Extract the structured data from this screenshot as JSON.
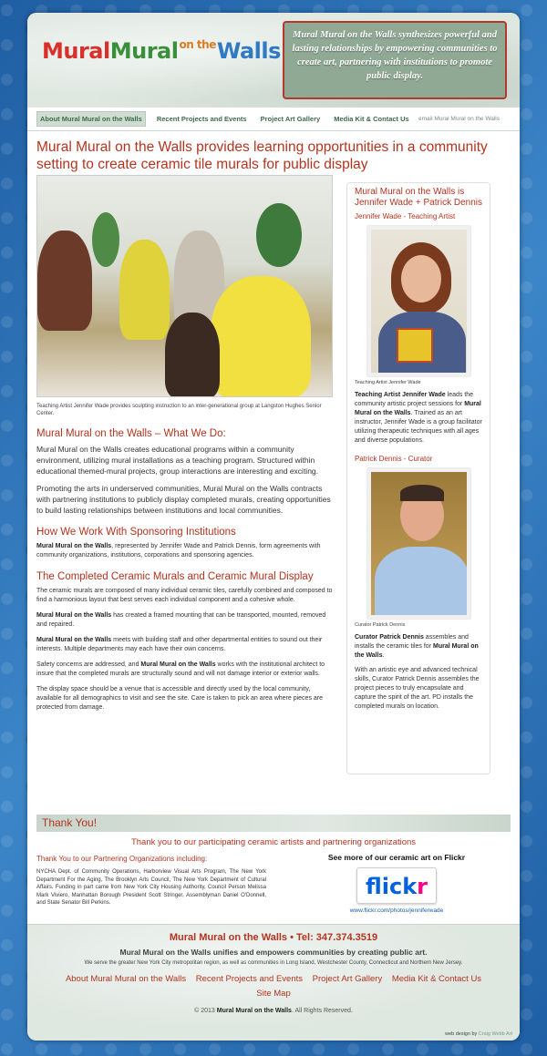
{
  "header": {
    "logo": [
      "Mural ",
      "Mural ",
      "on the",
      " Walls"
    ],
    "tagline": "Mural Mural on the Walls synthesizes powerful and lasting relationships by empowering communities to create art, partnering with institutions to promote public display."
  },
  "nav": {
    "items": [
      "About Mural Mural on the Walls",
      "Recent Projects and Events",
      "Project Art Gallery",
      "Media Kit & Contact Us"
    ],
    "email": "email Mural Mural on the Walls"
  },
  "headline": "Mural Mural on the Walls provides learning opportunities in a community setting to create ceramic tile murals for public display",
  "main": {
    "photo_caption": "Teaching Artist Jennifer Wade provides sculpting instruction to an inter-generational group at Langston Hughes Senior Center.",
    "s1_title": "Mural Mural on the Walls – What We Do:",
    "s1_p1": "Mural Mural on the Walls creates educational programs within a community environment, utilizing mural installations as a teaching program. Structured within educational themed-mural projects, group interactions are interesting and exciting.",
    "s1_p2": "Promoting the arts in underserved communities, Mural Mural on the Walls contracts with partnering institutions to publicly display completed murals, creating opportunities to build lasting relationships between institutions and local communities.",
    "s2_title": "How We Work With Sponsoring Institutions",
    "s2_b": "Mural Mural on the Walls",
    "s2_p": ", represented by Jennifer Wade and Patrick Dennis, form agreements with community organizations, institutions, corporations and sponsoring agencies.",
    "s3_title": "The Completed Ceramic Murals and Ceramic Mural Display",
    "s3_p1": "The ceramic murals are composed of many individual ceramic tiles, carefully combined and composed to find a harmonious layout that best serves each individual component and a cohesive whole.",
    "s3_p2b": "Mural Mural on the Walls",
    "s3_p2": " has created a framed mounting that can be transported, mounted, removed and repaired.",
    "s3_p3b": "Mural Mural on the Walls",
    "s3_p3": " meets with building staff and other departmental entities to sound out their interests. Multiple departments may each have their own concerns.",
    "s3_p4a": "Safety concerns are addressed, and ",
    "s3_p4b": "Mural Mural on the Walls",
    "s3_p4c": " works with the institutional architect to insure that the completed murals are structurally sound and will not damage interior or exterior walls.",
    "s3_p5": "The display space should be a venue that is accessible and directly used by the local community, available for all demographics to visit and see the site. Care is taken to pick an area where pieces are protected from damage."
  },
  "side": {
    "title": "Mural Mural on the Walls is Jennifer Wade + Patrick Dennis",
    "jw_sub": "Jennifer Wade - Teaching Artist",
    "jw_cap": "Teaching Artist Jennifer Wade",
    "jw_b1": "Teaching Artist Jennifer Wade",
    "jw_t1": " leads the community artistic project sessions for ",
    "jw_b2": "Mural Mural on the Walls",
    "jw_t2": ". Trained as an art instructor, Jennifer Wade is a group facilitator utilizing therapeutic techniques with all ages and diverse populations.",
    "pd_sub": "Patrick Dennis - Curator",
    "pd_cap": "Curator Patrick Dennis",
    "pd_b1": "Curator Patrick Dennis",
    "pd_t1": " assembles and installs the ceramic tiles for ",
    "pd_b2": "Mural Mural on the Walls",
    "pd_t2": ".",
    "pd_p2": "With an artistic eye and advanced technical skills, Curator Patrick Dennis assembles the project pieces to truly encapsulate and capture the spirit of the art. PD installs the completed murals on location."
  },
  "thanks": {
    "bar": "Thank You!",
    "sub": "Thank you to our participating ceramic artists and partnering organizations",
    "partners_title": "Thank You to our Partnering Organizations including:",
    "partners_text": "NYCHA Dept. of Community Operations, Harborview Visual Arts Program, The New York Department For the Aging, The Brooklyn Arts Council, The New York Department of Cultural Affairs. Funding in part came from New York City Housing Authority, Council Person Melissa Mark Viviero, Manhattan Borough President Scott Stringer, Assemblyman Daniel O'Donnell, and State Senator Bill Perkins.",
    "flickr_title": "See more of our ceramic art on Flickr",
    "flickr_logo_1": "flick",
    "flickr_logo_2": "r",
    "flickr_url": "www.flickr.com/photos/jenniferwade"
  },
  "footer": {
    "title": "Mural Mural on the Walls  •  Tel: 347.374.3519",
    "tag": "Mural Mural on the Walls unifies and empowers communities by creating public art.",
    "area": "We serve the greater New York City metropolitan region, as well as communities in Long Island, Westchester County, Connecticut and Northern New Jersey.",
    "links": [
      "About Mural Mural on the Walls",
      "Recent Projects and Events",
      "Project Art Gallery",
      "Media Kit & Contact Us"
    ],
    "sitemap": "Site Map",
    "copy_pre": "© 2013 ",
    "copy_b": "Mural Mural on the Walls",
    "copy_post": ".  All Rights Reserved.",
    "credit_pre": "web design by ",
    "credit_name": "Craig Webb Art"
  },
  "colors": {
    "accent": "#b3341f",
    "nav_text": "#3e6a4a",
    "background": "#2a6db3"
  }
}
